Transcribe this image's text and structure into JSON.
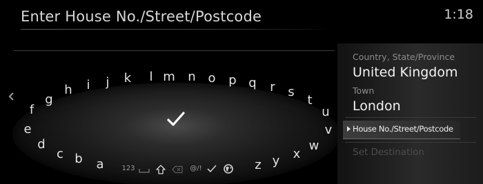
{
  "header": {
    "title": "Enter House No./Street/Postcode",
    "clock": "1:18"
  },
  "keyboard": {
    "letters": [
      "a",
      "b",
      "c",
      "d",
      "e",
      "f",
      "g",
      "h",
      "i",
      "j",
      "k",
      "l",
      "m",
      "n",
      "o",
      "p",
      "q",
      "r",
      "s",
      "t",
      "u",
      "v",
      "w",
      "x",
      "y",
      "z"
    ],
    "function_keys": {
      "numbers_label": "123",
      "symbols_label": "@/!"
    },
    "icons": {
      "back": "chevron-left-icon",
      "space": "space-bar-icon",
      "shift": "shift-icon",
      "delete": "backspace-icon",
      "confirm": "checkmark-icon",
      "language": "globe-icon"
    }
  },
  "side_panel": {
    "country_label": "Country, State/Province",
    "country_value": "United Kingdom",
    "town_label": "Town",
    "town_value": "London",
    "selected_item": "House No./Street/Postcode",
    "destination_button": "Set Destination"
  }
}
